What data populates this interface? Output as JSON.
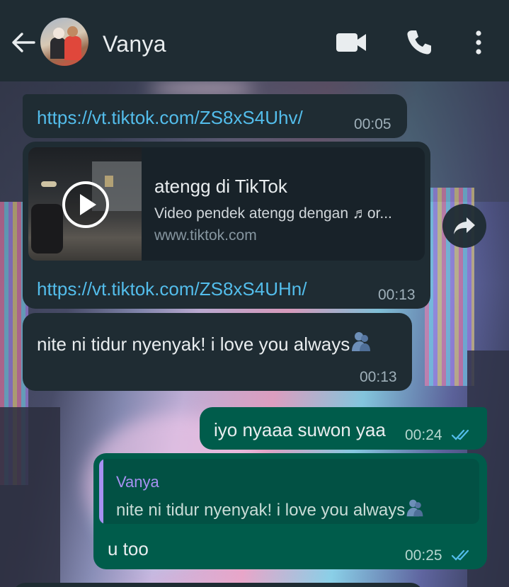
{
  "header": {
    "contact_name": "Vanya",
    "back_icon": "arrow-left-icon",
    "video_icon": "video-call-icon",
    "phone_icon": "phone-icon",
    "more_icon": "more-vertical-icon"
  },
  "messages": [
    {
      "direction": "in",
      "link": "https://vt.tiktok.com/ZS8xS4Uhv/",
      "time": "00:05"
    },
    {
      "direction": "in",
      "preview": {
        "title": "atengg di TikTok",
        "description": "Video pendek atengg dengan ♬or...",
        "domain": "www.tiktok.com"
      },
      "link": "https://vt.tiktok.com/ZS8xS4UHn/",
      "time": "00:13"
    },
    {
      "direction": "in",
      "text": "nite ni tidur nyenyak! i love you always",
      "time": "00:13"
    },
    {
      "direction": "out",
      "text": "iyo nyaaa suwon yaa",
      "time": "00:24",
      "status": "read"
    },
    {
      "direction": "out",
      "reply_to": {
        "name": "Vanya",
        "text": "nite ni tidur nyenyak! i love you always"
      },
      "text": "u too",
      "time": "00:25",
      "status": "read"
    }
  ],
  "colors": {
    "header_bg": "#1f2c33",
    "incoming_bubble": "#1f2c33",
    "outgoing_bubble": "#005c4b",
    "link": "#53bdeb",
    "read_ticks": "#53bdeb",
    "quote_name": "#a791f2"
  }
}
